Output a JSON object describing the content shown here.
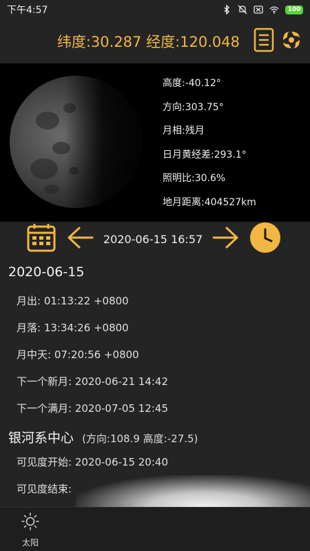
{
  "status_bar": {
    "time": "下午4:57",
    "battery": "100",
    "icons": [
      "bluetooth-icon",
      "mute-icon",
      "sim-off-icon",
      "wifi-icon",
      "battery-icon"
    ]
  },
  "header": {
    "coordinates": "纬度:30.287 经度:120.048",
    "icons": [
      "document-icon",
      "galaxy-swirl-icon"
    ],
    "accent_color": "#f2b742"
  },
  "moon_info": {
    "altitude": "高度:-40.12°",
    "azimuth": "方向:303.75°",
    "phase": "月相:残月",
    "elongation": "日月黄经差:293.1°",
    "illumination": "照明比:30.6%",
    "distance": "地月距离:404527km"
  },
  "date_nav": {
    "current": "2020-06-15 16:57",
    "icons": [
      "calendar-icon",
      "arrow-left-icon",
      "arrow-right-icon",
      "clock-icon"
    ]
  },
  "details": {
    "date": "2020-06-15",
    "moonrise": "月出: 01:13:22 +0800",
    "moonset": "月落: 13:34:26 +0800",
    "transit": "月中天: 07:20:56 +0800",
    "next_new_moon": "下一个新月: 2020-06-21 14:42",
    "next_full_moon": "下一个满月: 2020-07-05 12:45"
  },
  "galactic_center": {
    "title": "银河系中心",
    "position": "(方向:108.9 高度:-27.5)",
    "visibility_start": "可见度开始: 2020-06-15 20:40",
    "visibility_end": "可见度结束:"
  },
  "bottom_tab": {
    "label": "太阳",
    "icon": "sun-icon"
  }
}
